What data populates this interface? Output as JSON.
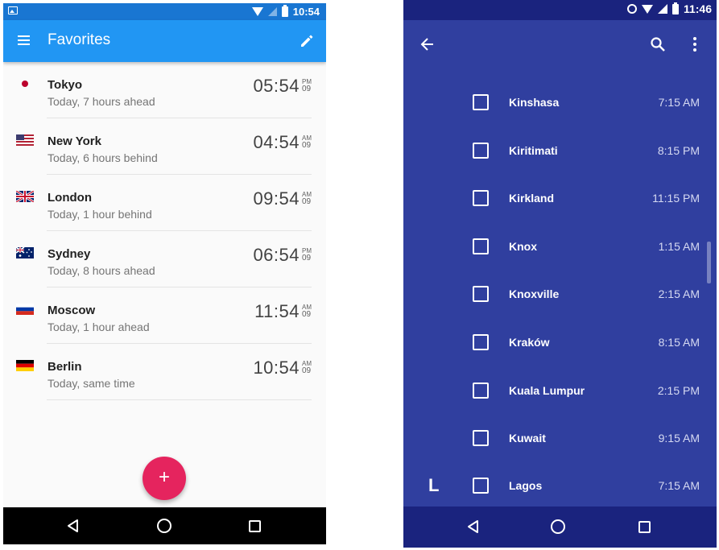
{
  "left_screen": {
    "status_bar": {
      "time": "10:54"
    },
    "appbar": {
      "title": "Favorites"
    },
    "favorites": [
      {
        "city": "Tokyo",
        "subtitle": "Today, 7 hours ahead",
        "time": "05:54",
        "ampm": "PM",
        "day": "09",
        "flag": "japan-flag-icon"
      },
      {
        "city": "New York",
        "subtitle": "Today, 6 hours behind",
        "time": "04:54",
        "ampm": "AM",
        "day": "09",
        "flag": "usa-flag-icon"
      },
      {
        "city": "London",
        "subtitle": "Today, 1 hour behind",
        "time": "09:54",
        "ampm": "AM",
        "day": "09",
        "flag": "uk-flag-icon"
      },
      {
        "city": "Sydney",
        "subtitle": "Today, 8 hours ahead",
        "time": "06:54",
        "ampm": "PM",
        "day": "09",
        "flag": "australia-flag-icon"
      },
      {
        "city": "Moscow",
        "subtitle": "Today, 1 hour ahead",
        "time": "11:54",
        "ampm": "AM",
        "day": "09",
        "flag": "russia-flag-icon"
      },
      {
        "city": "Berlin",
        "subtitle": "Today, same time",
        "time": "10:54",
        "ampm": "AM",
        "day": "09",
        "flag": "germany-flag-icon"
      }
    ],
    "fab_label": "+"
  },
  "right_screen": {
    "status_bar": {
      "time": "11:46"
    },
    "section_letter": "L",
    "timezones": [
      {
        "name": "Kinshasa",
        "time": "7:15 AM"
      },
      {
        "name": "Kiritimati",
        "time": "8:15 PM"
      },
      {
        "name": "Kirkland",
        "time": "11:15 PM"
      },
      {
        "name": "Knox",
        "time": "1:15 AM"
      },
      {
        "name": "Knoxville",
        "time": "2:15 AM"
      },
      {
        "name": "Kraków",
        "time": "8:15 AM"
      },
      {
        "name": "Kuala Lumpur",
        "time": "2:15 PM"
      },
      {
        "name": "Kuwait",
        "time": "9:15 AM"
      },
      {
        "name": "Lagos",
        "time": "7:15 AM"
      }
    ]
  },
  "colors": {
    "left_status": "#1976d2",
    "left_appbar": "#2196f3",
    "fab": "#e5245e",
    "right_background": "#303f9f",
    "right_bars": "#1a237e"
  }
}
